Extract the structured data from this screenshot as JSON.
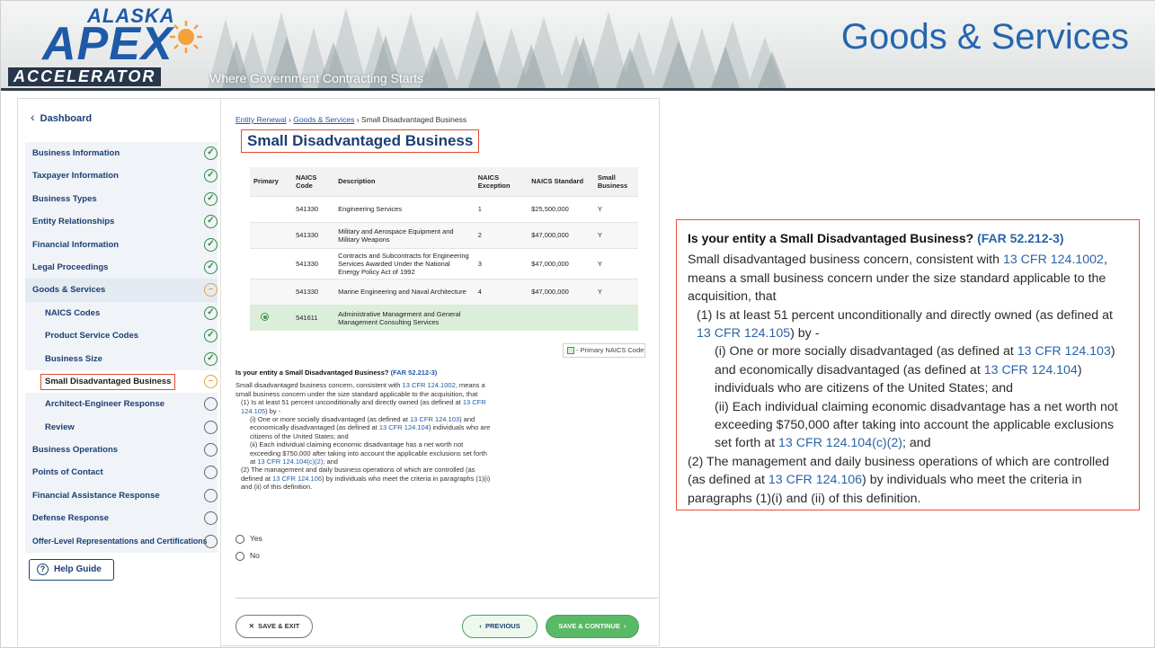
{
  "slide": {
    "logo": {
      "top": "ALASKA",
      "middle": "APEX",
      "bottom": "ACCELERATOR"
    },
    "tagline": "Where Government Contracting Starts",
    "title": "Goods & Services"
  },
  "sidebar": {
    "dashboard_label": "Dashboard",
    "items": [
      {
        "label": "Business Information",
        "status": "complete"
      },
      {
        "label": "Taxpayer Information",
        "status": "complete"
      },
      {
        "label": "Business Types",
        "status": "complete"
      },
      {
        "label": "Entity Relationships",
        "status": "complete"
      },
      {
        "label": "Financial Information",
        "status": "complete"
      },
      {
        "label": "Legal Proceedings",
        "status": "complete"
      },
      {
        "label": "Goods & Services",
        "status": "in-progress"
      },
      {
        "label": "NAICS Codes",
        "status": "complete"
      },
      {
        "label": "Product Service Codes",
        "status": "complete"
      },
      {
        "label": "Business Size",
        "status": "complete"
      },
      {
        "label": "Small Disadvantaged Business",
        "status": "in-progress"
      },
      {
        "label": "Architect-Engineer Response",
        "status": "not-started"
      },
      {
        "label": "Review",
        "status": "not-started"
      },
      {
        "label": "Business Operations",
        "status": "not-started"
      },
      {
        "label": "Points of Contact",
        "status": "not-started"
      },
      {
        "label": "Financial Assistance Response",
        "status": "not-started"
      },
      {
        "label": "Defense Response",
        "status": "not-started"
      },
      {
        "label": "Offer-Level Representations and Certifications",
        "status": "not-started"
      }
    ],
    "help_label": "Help Guide"
  },
  "main": {
    "breadcrumb": {
      "link1": "Entity Renewal",
      "link2": "Goods & Services",
      "current": "Small Disadvantaged Business",
      "sep": "›"
    },
    "page_title": "Small Disadvantaged Business",
    "table": {
      "headers": [
        "Primary",
        "NAICS Code",
        "Description",
        "NAICS Exception",
        "NAICS Standard",
        "Small Business"
      ],
      "rows": [
        {
          "primary": false,
          "code": "541330",
          "description": "Engineering Services",
          "exception": "1",
          "standard": "$25,500,000",
          "small": "Y"
        },
        {
          "primary": false,
          "code": "541330",
          "description": "Military and Aerospace Equipment and Military Weapons",
          "exception": "2",
          "standard": "$47,000,000",
          "small": "Y"
        },
        {
          "primary": false,
          "code": "541330",
          "description": "Contracts and Subcontracts for Engineering Services Awarded Under the National Energy Policy Act of 1992",
          "exception": "3",
          "standard": "$47,000,000",
          "small": "Y"
        },
        {
          "primary": false,
          "code": "541330",
          "description": "Marine Engineering and Naval Architecture",
          "exception": "4",
          "standard": "$47,000,000",
          "small": "Y"
        },
        {
          "primary": true,
          "code": "541611",
          "description": "Administrative Management and General Management Consulting Services",
          "exception": "",
          "standard": "",
          "small": ""
        }
      ]
    },
    "legend_label": "- Primary NAICS Code",
    "options": {
      "yes": "Yes",
      "no": "No"
    },
    "buttons": {
      "save_exit": "SAVE & EXIT",
      "previous": "PREVIOUS",
      "save_continue": "SAVE & CONTINUE"
    }
  },
  "question": {
    "heading": "Is your entity a Small Disadvantaged Business?",
    "far_ref": "(FAR 52.212-3)",
    "p1a": "Small disadvantaged business concern, consistent with ",
    "cfr1": "13 CFR 124.1002",
    "p1b": ", means a small business concern under the size standard applicable to the acquisition, that",
    "p2a": "(1) Is at least 51 percent unconditionally and directly owned (as defined at ",
    "cfr2": "13 CFR 124.105",
    "p2b": ") by -",
    "p3a": "(i) One or more socially disadvantaged (as defined at ",
    "cfr3": "13 CFR 124.103",
    "p3b": ") and economically disadvantaged (as defined at ",
    "cfr4": "13 CFR 124.104",
    "p3c": ") individuals who are citizens of the United States; and",
    "p4a": "(ii) Each individual claiming economic disadvantage has a net worth not exceeding $750,000 after taking into account the applicable exclusions set forth at ",
    "cfr5": "13 CFR 124.104(c)(2)",
    "p4b": "; and",
    "p5a": "(2) The management and daily business operations of which are controlled (as defined at ",
    "cfr6": "13 CFR 124.106",
    "p5b": ") by individuals who meet the criteria in paragraphs (1)(i) and (ii) of this definition."
  },
  "colors": {
    "brand_blue": "#2566ad",
    "nav_text": "#1b3f73",
    "highlight_red": "#e24a2b",
    "complete_green": "#2e8b3e",
    "progress_orange": "#e7a23a",
    "selected_row": "#dbeed9"
  },
  "icons": {
    "complete": "check-circle-icon",
    "in_progress": "minus-circle-icon",
    "not_started": "empty-circle-icon",
    "help": "question-circle-icon",
    "back": "chevron-left-icon"
  }
}
